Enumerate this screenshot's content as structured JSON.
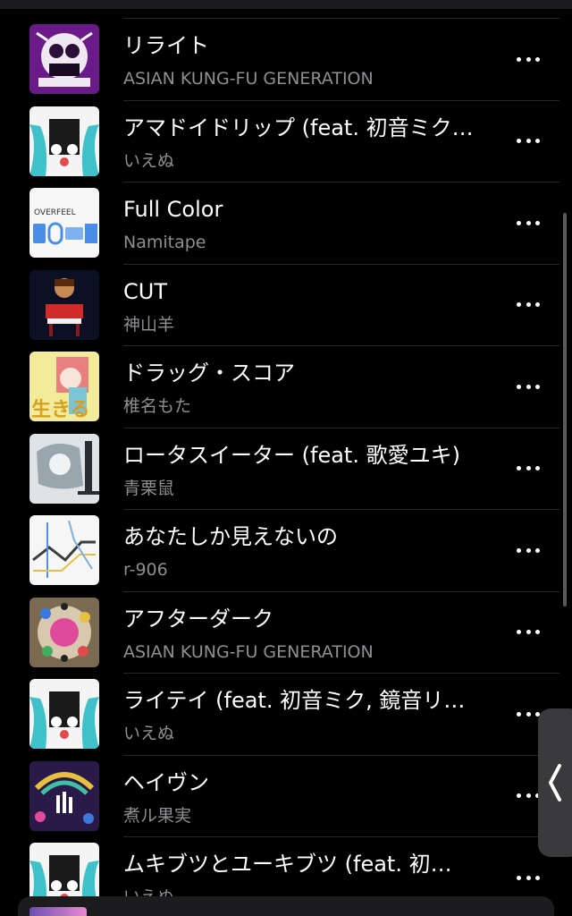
{
  "tracks": [
    {
      "title": "リライト",
      "artist": "ASIAN KUNG-FU GENERATION",
      "art": "purple-mosaic"
    },
    {
      "title": "アマドイドリップ (feat. 初音ミク…",
      "artist": "いえぬ",
      "art": "miku-teal"
    },
    {
      "title": "Full Color",
      "artist": "Namitape",
      "art": "overfeel-blue",
      "art_label": "OVERFEEL"
    },
    {
      "title": "CUT",
      "artist": "神山羊",
      "art": "red-piano"
    },
    {
      "title": "ドラッグ・スコア",
      "artist": "椎名もた",
      "art": "yellow-girl",
      "art_label": "生きる"
    },
    {
      "title": "ロータスイーター (feat. 歌愛ユキ)",
      "artist": "青栗鼠",
      "art": "sketch-grey"
    },
    {
      "title": "あなたしか見えないの",
      "artist": "r-906",
      "art": "map-lines"
    },
    {
      "title": "アフターダーク",
      "artist": "ASIAN KUNG-FU GENERATION",
      "art": "pink-crowd"
    },
    {
      "title": "ライテイ (feat. 初音ミク, 鏡音リ…",
      "artist": "いえぬ",
      "art": "miku-teal"
    },
    {
      "title": "ヘイヴン",
      "artist": "煮ル果実",
      "art": "dark-colorful"
    },
    {
      "title": "ムキブツとユーキブツ (feat. 初…",
      "artist": "いえぬ",
      "art": "miku-teal"
    }
  ],
  "more_icon": "ellipsis-icon",
  "side_handle_icon": "chevron-left-icon"
}
